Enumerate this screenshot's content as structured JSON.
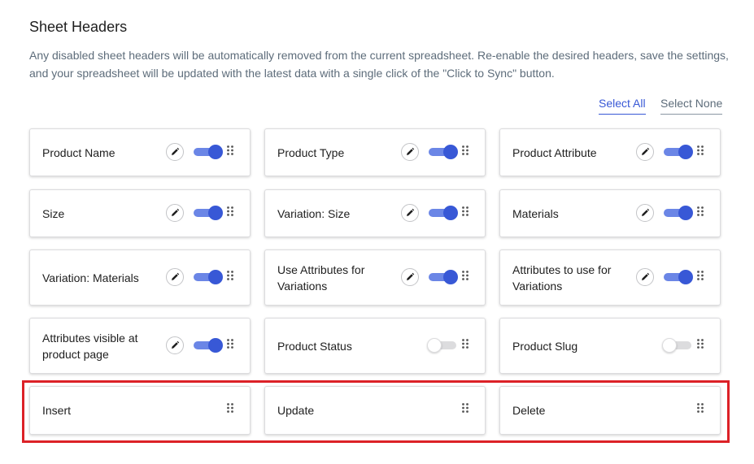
{
  "section": {
    "title": "Sheet Headers",
    "description": "Any disabled sheet headers will be automatically removed from the current spreadsheet. Re-enable the desired headers, save the settings, and your spreadsheet will be updated with the latest data with a single click of the \"Click to Sync\" button."
  },
  "actions": {
    "select_all": "Select All",
    "select_none": "Select None"
  },
  "colors": {
    "accent": "#3858d6",
    "toggle_track_on": "#6b86e6",
    "highlight": "#dc2127"
  },
  "headers": [
    {
      "label": "Product Name",
      "enabled": true,
      "editable": true
    },
    {
      "label": "Product Type",
      "enabled": true,
      "editable": true
    },
    {
      "label": "Product Attribute",
      "enabled": true,
      "editable": true
    },
    {
      "label": "Size",
      "enabled": true,
      "editable": true
    },
    {
      "label": "Variation: Size",
      "enabled": true,
      "editable": true
    },
    {
      "label": "Materials",
      "enabled": true,
      "editable": true
    },
    {
      "label": "Variation: Materials",
      "enabled": true,
      "editable": true
    },
    {
      "label": "Use Attributes for Variations",
      "enabled": true,
      "editable": true
    },
    {
      "label": "Attributes to use for Variations",
      "enabled": true,
      "editable": true
    },
    {
      "label": "Attributes visible at product page",
      "enabled": true,
      "editable": true
    },
    {
      "label": "Product Status",
      "enabled": false,
      "editable": false
    },
    {
      "label": "Product Slug",
      "enabled": false,
      "editable": false
    },
    {
      "label": "Insert",
      "enabled": null,
      "editable": false
    },
    {
      "label": "Update",
      "enabled": null,
      "editable": false
    },
    {
      "label": "Delete",
      "enabled": null,
      "editable": false
    }
  ],
  "icons": {
    "edit": "pencil-icon",
    "drag": "drag-handle-icon"
  }
}
